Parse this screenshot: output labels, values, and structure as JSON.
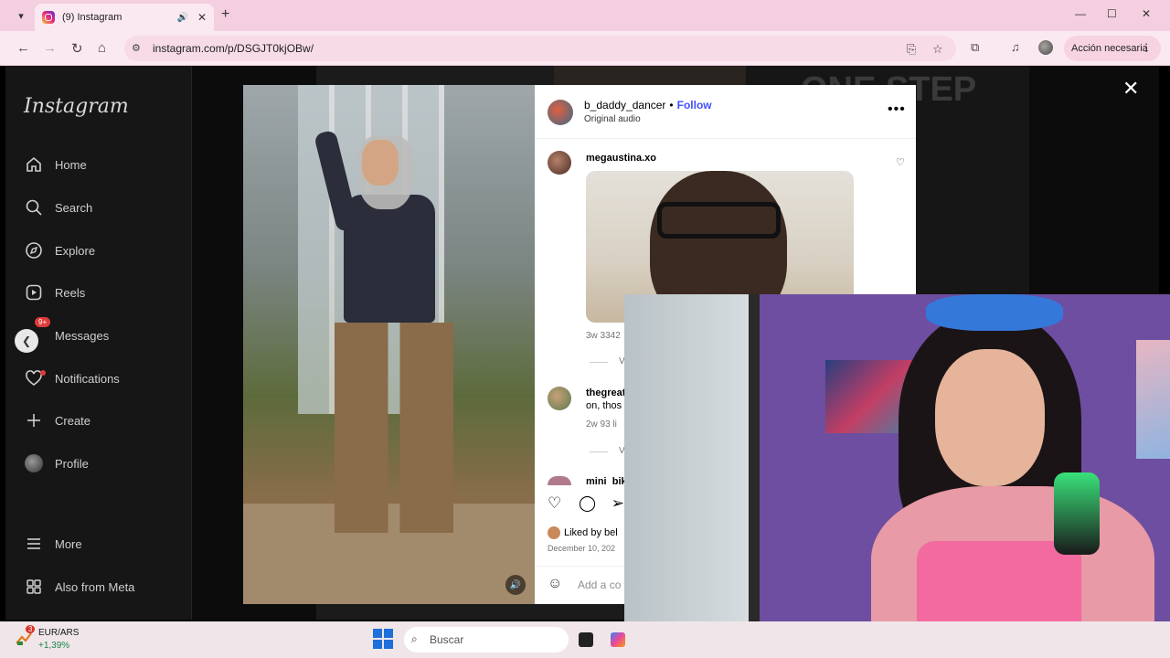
{
  "browser": {
    "tab_title": "(9) Instagram",
    "url": "instagram.com/p/DSGJT0kjOBw/",
    "action_button": "Acción necesaria"
  },
  "instagram": {
    "logo": "Instagram",
    "nav": [
      {
        "label": "Home",
        "icon": "home-icon"
      },
      {
        "label": "Search",
        "icon": "search-icon"
      },
      {
        "label": "Explore",
        "icon": "compass-icon"
      },
      {
        "label": "Reels",
        "icon": "reels-icon"
      },
      {
        "label": "Messages",
        "icon": "messenger-icon",
        "badge": "9+"
      },
      {
        "label": "Notifications",
        "icon": "heart-icon"
      },
      {
        "label": "Create",
        "icon": "plus-icon"
      },
      {
        "label": "Profile",
        "icon": "avatar-icon"
      },
      {
        "label": "More",
        "icon": "menu-icon"
      },
      {
        "label": "Also from Meta",
        "icon": "meta-grid-icon"
      }
    ],
    "background_text": "ONE STEP\nER"
  },
  "post": {
    "username": "b_daddy_dancer",
    "separator": "•",
    "follow": "Follow",
    "audio": "Original audio",
    "comments": [
      {
        "user": "megaustina.xo",
        "meta": "3w   3342"
      },
      {
        "user": "thegreat",
        "text": "on, thos",
        "meta": "2w   93 li"
      },
      {
        "user": "mini_bik"
      }
    ],
    "view_replies": "V",
    "liked_by": "Liked by bel",
    "date": "December 10, 202",
    "add_comment": "Add a co"
  },
  "taskbar": {
    "ticker_name": "EUR/ARS",
    "ticker_change": "+1,39%",
    "widget_badge": "3",
    "search_placeholder": "Buscar"
  }
}
